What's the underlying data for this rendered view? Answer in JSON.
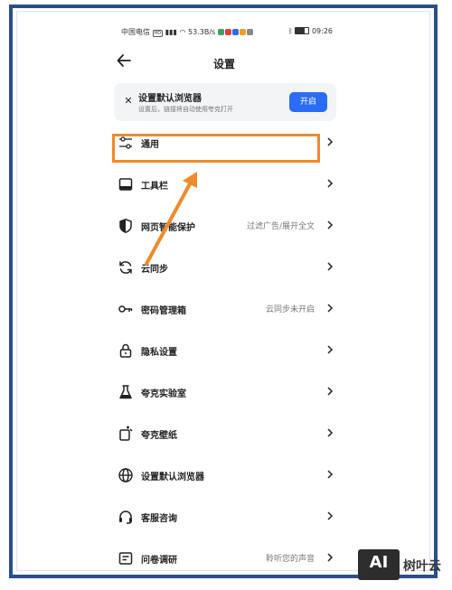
{
  "status_bar": {
    "carrier": "中国电信",
    "speed": "53.3B/s",
    "time": "09:26"
  },
  "header": {
    "title": "设置"
  },
  "banner": {
    "title": "设置默认浏览器",
    "subtitle": "设置后，链接将自动使用夸克打开",
    "button": "开启",
    "button_color": "#2a6cf6"
  },
  "menu": {
    "items": [
      {
        "label": "通用",
        "value": "",
        "icon": "sliders-icon"
      },
      {
        "label": "工具栏",
        "value": "",
        "icon": "toolbar-icon"
      },
      {
        "label": "网页智能保护",
        "value": "过滤广告/展开全文",
        "icon": "shield-icon"
      },
      {
        "label": "云同步",
        "value": "",
        "icon": "sync-icon"
      },
      {
        "label": "密码管理箱",
        "value": "云同步未开启",
        "icon": "key-icon"
      },
      {
        "label": "隐私设置",
        "value": "",
        "icon": "lock-icon"
      },
      {
        "label": "夸克实验室",
        "value": "",
        "icon": "flask-icon"
      },
      {
        "label": "夸克壁纸",
        "value": "",
        "icon": "wallpaper-icon"
      },
      {
        "label": "设置默认浏览器",
        "value": "",
        "icon": "globe-icon"
      },
      {
        "label": "客服咨询",
        "value": "",
        "icon": "headset-icon"
      },
      {
        "label": "问卷调研",
        "value": "聆听您的声音",
        "icon": "survey-icon"
      }
    ]
  },
  "annotation": {
    "highlight_color": "#f08a2c"
  },
  "watermark": {
    "logo": "AI",
    "text": "树叶云"
  }
}
